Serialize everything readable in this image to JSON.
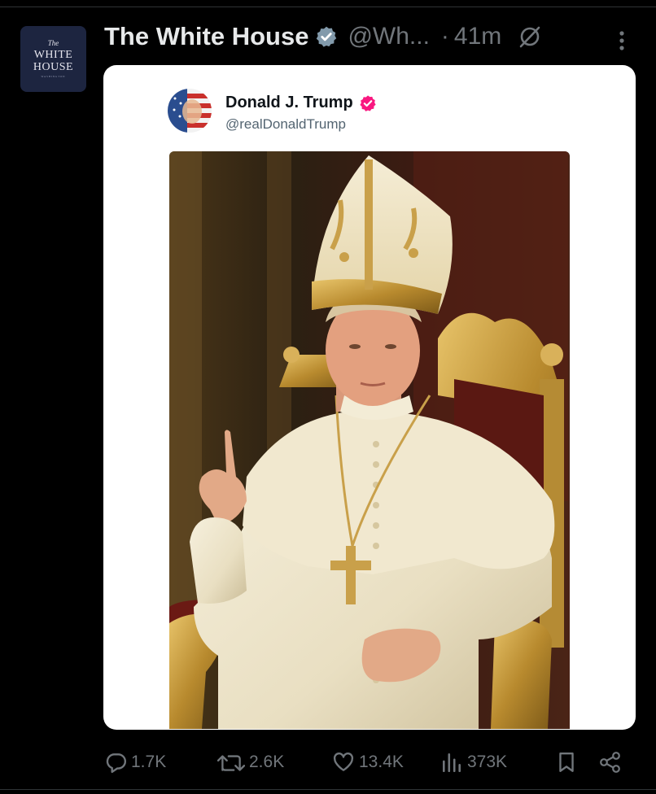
{
  "post": {
    "author_name": "The White House",
    "author_handle": "@Wh...",
    "separator": "·",
    "time": "41m"
  },
  "avatar": {
    "line1": "The",
    "line2": "WHITE",
    "line3": "HOUSE",
    "line4": "WASHINGTON"
  },
  "quoted": {
    "author_name": "Donald J. Trump",
    "author_handle": "@realDonaldTrump"
  },
  "actions": {
    "replies": "1.7K",
    "reposts": "2.6K",
    "likes": "13.4K",
    "views": "373K"
  },
  "colors": {
    "background": "#000000",
    "verified_business": "#829aab",
    "verified_blue": "#f91880",
    "muted": "#71767b"
  }
}
